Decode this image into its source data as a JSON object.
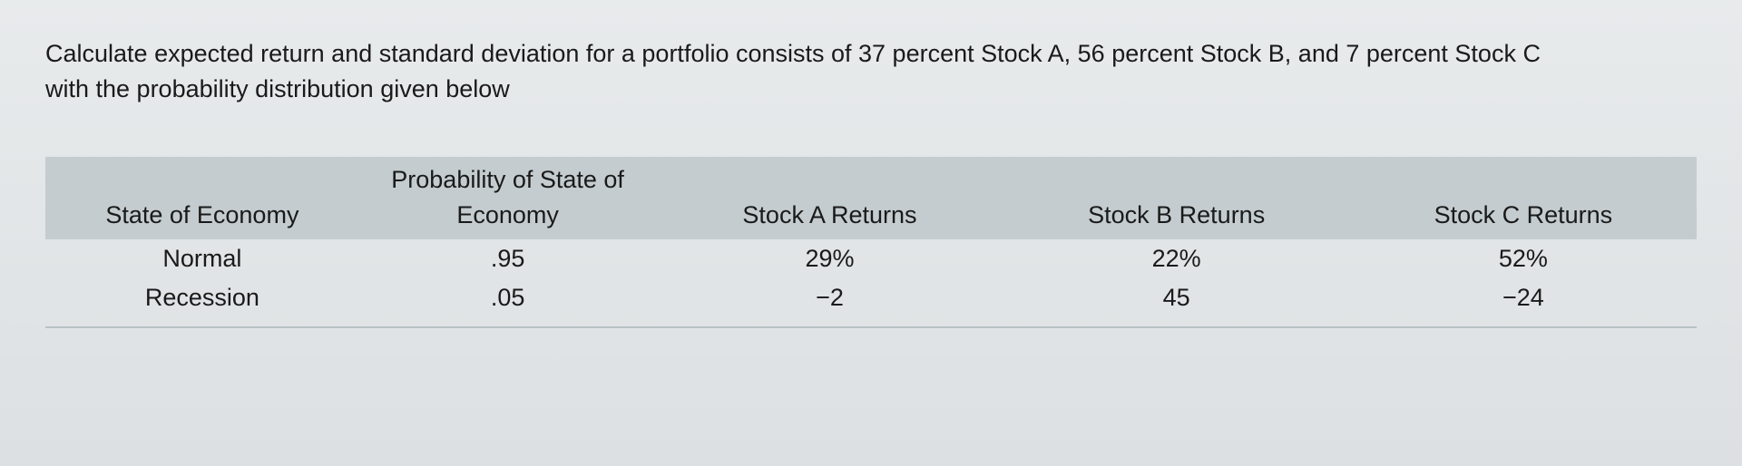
{
  "question": "Calculate expected return and standard deviation for a portfolio consists of 37 percent Stock A, 56 percent Stock B, and 7 percent Stock C with the probability distribution given below",
  "table": {
    "headers": {
      "state": "State of Economy",
      "probability": "Probability of State of Economy",
      "stockA": "Stock A Returns",
      "stockB": "Stock B Returns",
      "stockC": "Stock C Returns"
    },
    "rows": [
      {
        "state": "Normal",
        "probability": ".95",
        "stockA": "29%",
        "stockB": "22%",
        "stockC": "52%"
      },
      {
        "state": "Recession",
        "probability": ".05",
        "stockA": "−2",
        "stockB": "45",
        "stockC": "−24"
      }
    ]
  },
  "chart_data": {
    "type": "table",
    "columns": [
      "State of Economy",
      "Probability of State of Economy",
      "Stock A Returns",
      "Stock B Returns",
      "Stock C Returns"
    ],
    "rows": [
      [
        "Normal",
        0.95,
        29,
        22,
        52
      ],
      [
        "Recession",
        0.05,
        -2,
        45,
        -24
      ]
    ],
    "units": {
      "Stock A Returns": "percent",
      "Stock B Returns": "percent",
      "Stock C Returns": "percent"
    },
    "portfolio_weights": {
      "Stock A": 0.37,
      "Stock B": 0.56,
      "Stock C": 0.07
    }
  }
}
